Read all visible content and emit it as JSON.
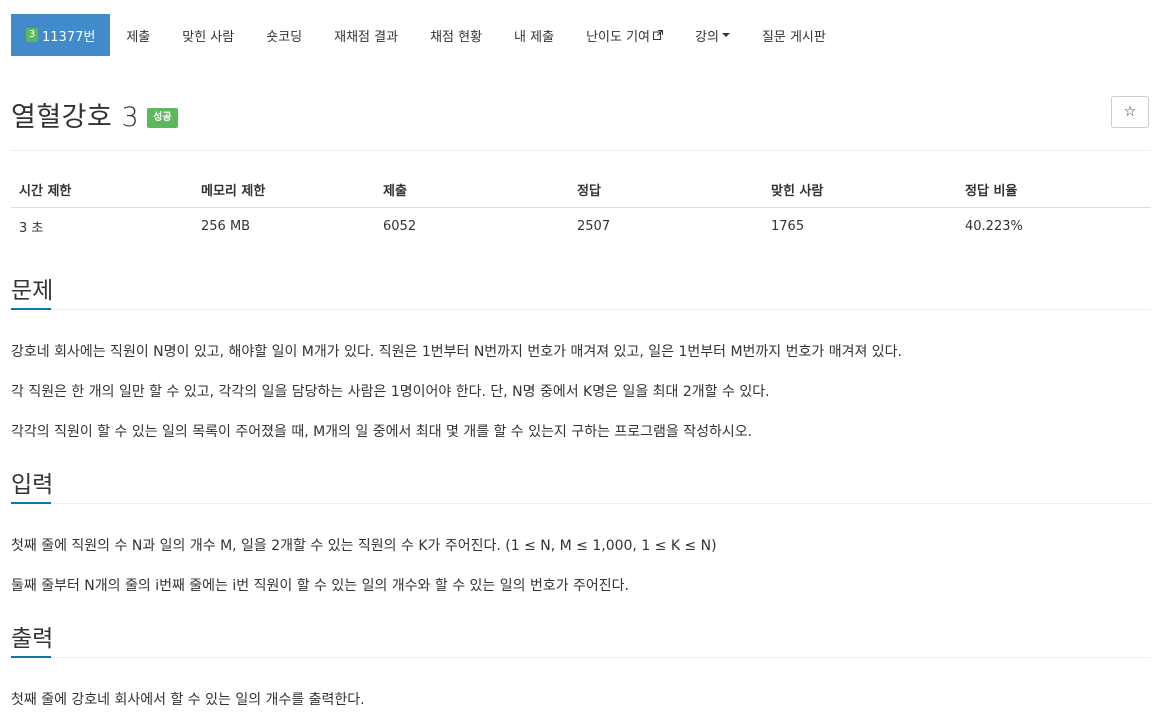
{
  "nav": {
    "problem_number": "11377번",
    "problem_badge": "3",
    "tabs": [
      "제출",
      "맞힌 사람",
      "숏코딩",
      "재채점 결과",
      "채점 현황",
      "내 제출",
      "난이도 기여",
      "강의",
      "질문 게시판"
    ]
  },
  "problem": {
    "title": "열혈강호 3",
    "status": "성공",
    "star_icon": "☆"
  },
  "info_table": {
    "headers": [
      "시간 제한",
      "메모리 제한",
      "제출",
      "정답",
      "맞힌 사람",
      "정답 비율"
    ],
    "values": [
      "3 초",
      "256 MB",
      "6052",
      "2507",
      "1765",
      "40.223%"
    ]
  },
  "sections": {
    "description": {
      "title": "문제",
      "paragraphs": [
        "강호네 회사에는 직원이 N명이 있고, 해야할 일이 M개가 있다. 직원은 1번부터 N번까지 번호가 매겨져 있고, 일은 1번부터 M번까지 번호가 매겨져 있다.",
        "각 직원은 한 개의 일만 할 수 있고, 각각의 일을 담당하는 사람은 1명이어야 한다. 단, N명 중에서 K명은 일을 최대 2개할 수 있다.",
        "각각의 직원이 할 수 있는 일의 목록이 주어졌을 때, M개의 일 중에서 최대 몇 개를 할 수 있는지 구하는 프로그램을 작성하시오."
      ]
    },
    "input": {
      "title": "입력",
      "paragraphs": [
        "첫째 줄에 직원의 수 N과 일의 개수 M, 일을 2개할 수 있는 직원의 수 K가 주어진다. (1 ≤ N, M ≤ 1,000, 1 ≤ K ≤ N)",
        "둘째 줄부터 N개의 줄의 i번째 줄에는 i번 직원이 할 수 있는 일의 개수와 할 수 있는 일의 번호가 주어진다."
      ]
    },
    "output": {
      "title": "출력",
      "paragraphs": [
        "첫째 줄에 강호네 회사에서 할 수 있는 일의 개수를 출력한다."
      ]
    }
  },
  "colors": {
    "active_tab": "#428bca",
    "success_badge": "#5cb85c",
    "section_accent": "#0e76a8"
  }
}
